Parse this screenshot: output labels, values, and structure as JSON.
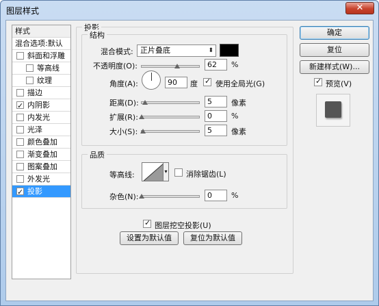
{
  "window": {
    "title": "图层样式",
    "close_label": "✕"
  },
  "styles_panel": {
    "header": "样式",
    "blend_default": "混合选项:默认",
    "items": [
      {
        "label": "斜面和浮雕",
        "checked": false,
        "indent": false
      },
      {
        "label": "等高线",
        "checked": false,
        "indent": true
      },
      {
        "label": "纹理",
        "checked": false,
        "indent": true
      },
      {
        "label": "描边",
        "checked": false,
        "indent": false
      },
      {
        "label": "内阴影",
        "checked": true,
        "indent": false
      },
      {
        "label": "内发光",
        "checked": false,
        "indent": false
      },
      {
        "label": "光泽",
        "checked": false,
        "indent": false
      },
      {
        "label": "颜色叠加",
        "checked": false,
        "indent": false
      },
      {
        "label": "渐变叠加",
        "checked": false,
        "indent": false
      },
      {
        "label": "图案叠加",
        "checked": false,
        "indent": false
      },
      {
        "label": "外发光",
        "checked": false,
        "indent": false
      },
      {
        "label": "投影",
        "checked": true,
        "indent": false,
        "selected": true
      }
    ]
  },
  "drop_shadow": {
    "section_title": "投影",
    "structure": {
      "title": "结构",
      "blend_mode_label": "混合模式:",
      "blend_mode_value": "正片叠底",
      "shadow_color": "#000000",
      "opacity_label": "不透明度(O):",
      "opacity_value": "62",
      "opacity_unit": "%",
      "opacity_level": 0.62,
      "angle_label": "角度(A):",
      "angle_value": "90",
      "angle_unit": "度",
      "global_light_label": "使用全局光(G)",
      "global_light_checked": true,
      "distance_label": "距离(D):",
      "distance_value": "5",
      "distance_unit": "像素",
      "spread_label": "扩展(R):",
      "spread_value": "0",
      "spread_unit": "%",
      "size_label": "大小(S):",
      "size_value": "5",
      "size_unit": "像素"
    },
    "quality": {
      "title": "品质",
      "contour_label": "等高线:",
      "anti_alias_label": "消除锯齿(L)",
      "anti_alias_checked": false,
      "noise_label": "杂色(N):",
      "noise_value": "0",
      "noise_unit": "%"
    },
    "knockout_label": "图层挖空投影(U)",
    "knockout_checked": true,
    "make_default_label": "设置为默认值",
    "reset_default_label": "复位为默认值"
  },
  "actions": {
    "ok_label": "确定",
    "reset_label": "复位",
    "new_style_label": "新建样式(W)...",
    "preview_label": "预览(V)",
    "preview_checked": true
  }
}
